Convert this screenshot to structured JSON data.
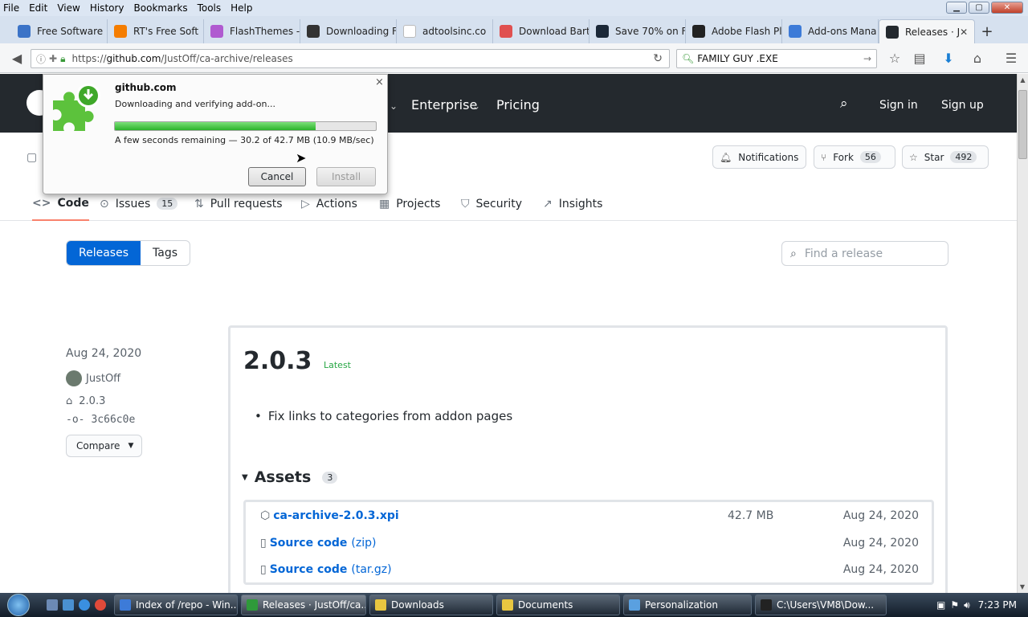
{
  "menubar": {
    "items": [
      "File",
      "Edit",
      "View",
      "History",
      "Bookmarks",
      "Tools",
      "Help"
    ]
  },
  "window_controls": {
    "minimize": "▁",
    "maximize": "▢",
    "close": "✕"
  },
  "tabs": [
    {
      "label": "Free Software",
      "color": "#3b73c7"
    },
    {
      "label": "RT's Free Soft",
      "color": "#f57d00"
    },
    {
      "label": "FlashThemes -",
      "color": "#b05ad0"
    },
    {
      "label": "Downloading F",
      "color": "#333333"
    },
    {
      "label": "adtoolsinc.co",
      "color": "#ffffff"
    },
    {
      "label": "Download Bart",
      "color": "#e05050"
    },
    {
      "label": "Save 70% on F",
      "color": "#1b2838"
    },
    {
      "label": "Adobe Flash Pl",
      "color": "#222222"
    },
    {
      "label": "Add-ons Mana",
      "color": "#3d7bd8"
    },
    {
      "label": "Releases · J",
      "color": "#24292e",
      "active": true
    }
  ],
  "navbar": {
    "url_scheme": "https://",
    "url_domain": "github.com",
    "url_path": "/JustOff/ca-archive/releases",
    "search_value": "FAMILY GUY .EXE"
  },
  "github": {
    "nav_enterprise": "Enterprise",
    "nav_pricing": "Pricing",
    "sign_in": "Sign in",
    "sign_up": "Sign up",
    "notifications": "Notifications",
    "fork_label": "Fork",
    "fork_count": "56",
    "star_label": "Star",
    "star_count": "492"
  },
  "repo_tabs": [
    {
      "label": "Code",
      "icon": "<>"
    },
    {
      "label": "Issues",
      "icon": "⊙",
      "count": "15"
    },
    {
      "label": "Pull requests",
      "icon": "⇅"
    },
    {
      "label": "Actions",
      "icon": "▷"
    },
    {
      "label": "Projects",
      "icon": "▦"
    },
    {
      "label": "Security",
      "icon": "⛉"
    },
    {
      "label": "Insights",
      "icon": "↗"
    }
  ],
  "releases_toggle": {
    "releases": "Releases",
    "tags": "Tags"
  },
  "find_placeholder": "Find a release",
  "release": {
    "date": "Aug 24, 2020",
    "author": "JustOff",
    "tag": "2.0.3",
    "commit": "3c66c0e",
    "compare": "Compare",
    "title": "2.0.3",
    "badge": "Latest",
    "notes": [
      "Fix links to categories from addon pages"
    ],
    "assets_title": "Assets",
    "assets_count": "3",
    "assets": [
      {
        "name": "ca-archive-2.0.3.xpi",
        "suffix": "",
        "size": "42.7 MB",
        "date": "Aug 24, 2020"
      },
      {
        "name": "Source code",
        "suffix": "(zip)",
        "size": "",
        "date": "Aug 24, 2020"
      },
      {
        "name": "Source code",
        "suffix": "(tar.gz)",
        "size": "",
        "date": "Aug 24, 2020"
      }
    ]
  },
  "popup": {
    "site": "github.com",
    "status": "Downloading and verifying add-on...",
    "progress": 0.77,
    "remaining": "A few seconds remaining — 30.2 of 42.7 MB (10.9 MB/sec)",
    "cancel": "Cancel",
    "install": "Install",
    "close": "×"
  },
  "taskbar": {
    "items": [
      {
        "label": "Index of /repo - Win...",
        "color": "#3d7bd8"
      },
      {
        "label": "Releases · JustOff/ca...",
        "color": "#2f9a3a",
        "active": true
      },
      {
        "label": "Downloads",
        "color": "#e8c640"
      },
      {
        "label": "Documents",
        "color": "#e8c640"
      },
      {
        "label": "Personalization",
        "color": "#5aa0e0"
      },
      {
        "label": "C:\\Users\\VM8\\Dow...",
        "color": "#222222"
      }
    ],
    "clock": "7:23 PM"
  }
}
